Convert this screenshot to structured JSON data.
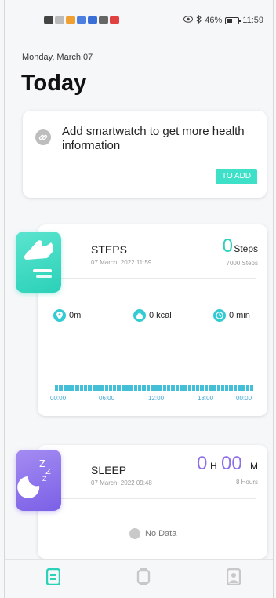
{
  "status_bar": {
    "battery_percent": "46%",
    "time": "11:59"
  },
  "header": {
    "date": "Monday, March 07",
    "title": "Today"
  },
  "add_watch": {
    "message": "Add smartwatch to get more health information",
    "button_label": "TO ADD"
  },
  "steps": {
    "title": "STEPS",
    "timestamp": "07 March, 2022 11:59",
    "value": "0",
    "unit": "Steps",
    "goal": "7000 Steps",
    "distance": "0m",
    "calories": "0 kcal",
    "duration": "0 min",
    "time_ticks": [
      "00:00",
      "06:00",
      "12:00",
      "18:00",
      "00:00"
    ]
  },
  "sleep": {
    "title": "SLEEP",
    "timestamp": "07 March, 2022 09:48",
    "hours": "0",
    "hours_unit": "H",
    "minutes": "00",
    "minutes_unit": "M",
    "goal": "8 Hours",
    "no_data": "No Data"
  },
  "colors": {
    "accent_teal": "#2bd1b8",
    "accent_purple": "#8e6fe8",
    "chart_blue": "#43c0d7"
  }
}
